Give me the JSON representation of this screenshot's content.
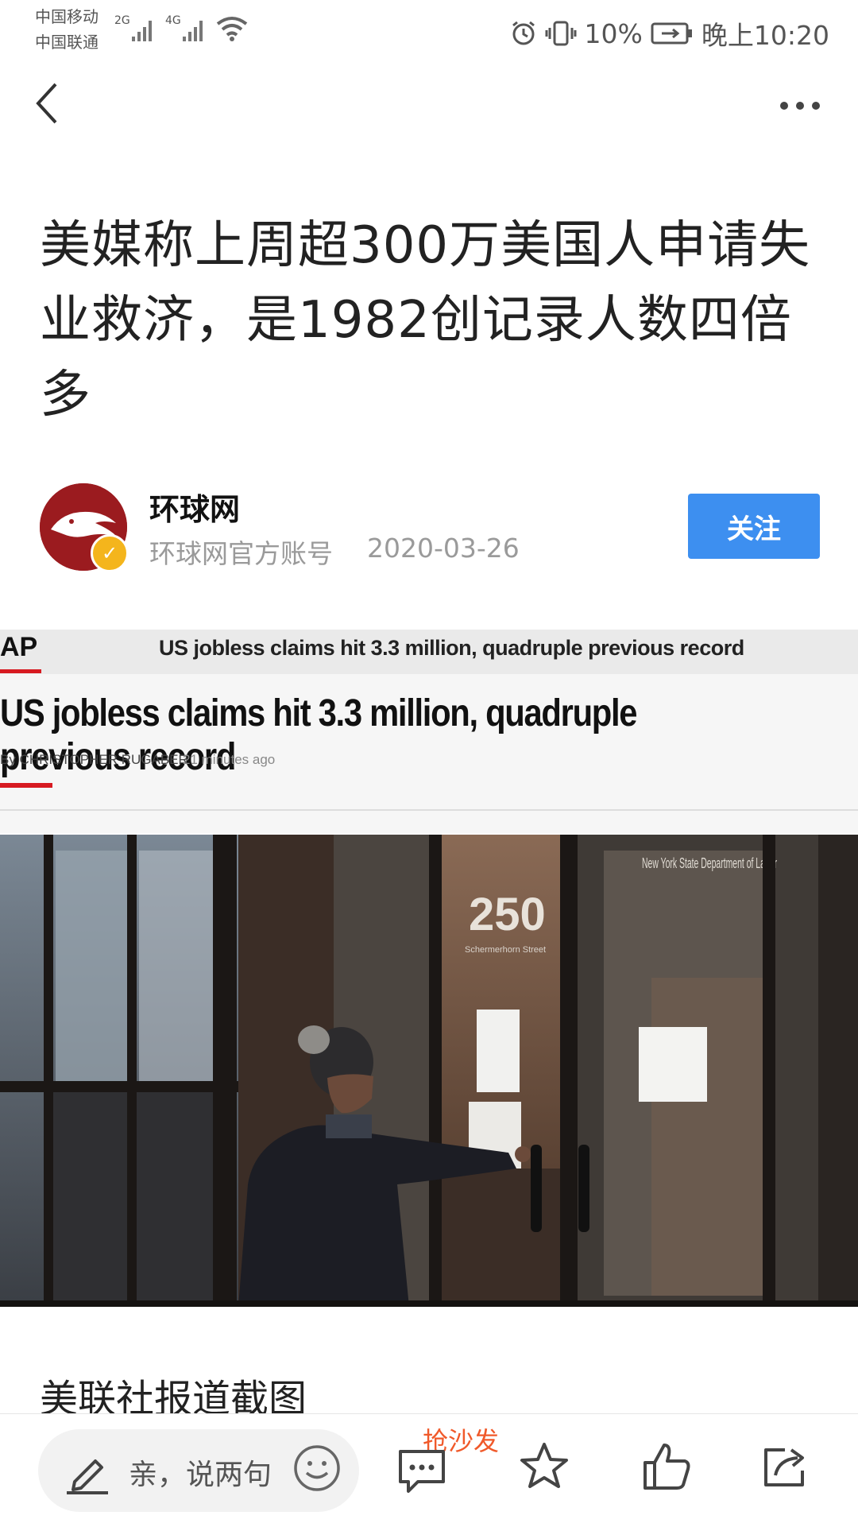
{
  "status_bar": {
    "carrier1": "中国移动",
    "carrier2": "中国联通",
    "net1": "2G",
    "net2": "4G",
    "battery": "10%",
    "time": "晚上10:20"
  },
  "article": {
    "title": "美媒称上周超300万美国人申请失业救济，是1982创记录人数四倍多",
    "author_name": "环球网",
    "author_sub": "环球网官方账号",
    "date": "2020-03-26",
    "follow_label": "关注",
    "caption": "美联社报道截图"
  },
  "screenshot": {
    "logo": "AP",
    "header_text": "US jobless claims hit 3.3 million, quadruple previous record",
    "headline": "US jobless claims hit 3.3 million, quadruple previous record",
    "byline": "By CHRISTOPHER RUGABER",
    "time_ago": "21 minutes ago",
    "building_number": "250",
    "building_street": "Schermerhorn Street",
    "sign_text": "New York State Department of Labor"
  },
  "bottom_bar": {
    "comment_placeholder": "亲，说两句",
    "sofa_label": "抢沙发"
  },
  "icons": {
    "back": "chevron-left-icon",
    "more": "more-dots-icon",
    "pen": "pen-icon",
    "smile": "smile-icon",
    "comment": "comment-icon",
    "star": "star-icon",
    "like": "thumbs-up-icon",
    "share": "share-icon"
  },
  "colors": {
    "follow_button": "#3d8ff0",
    "sofa_label": "#f0592a",
    "avatar_bg": "#9b1b1f",
    "ap_red": "#d71a21"
  }
}
